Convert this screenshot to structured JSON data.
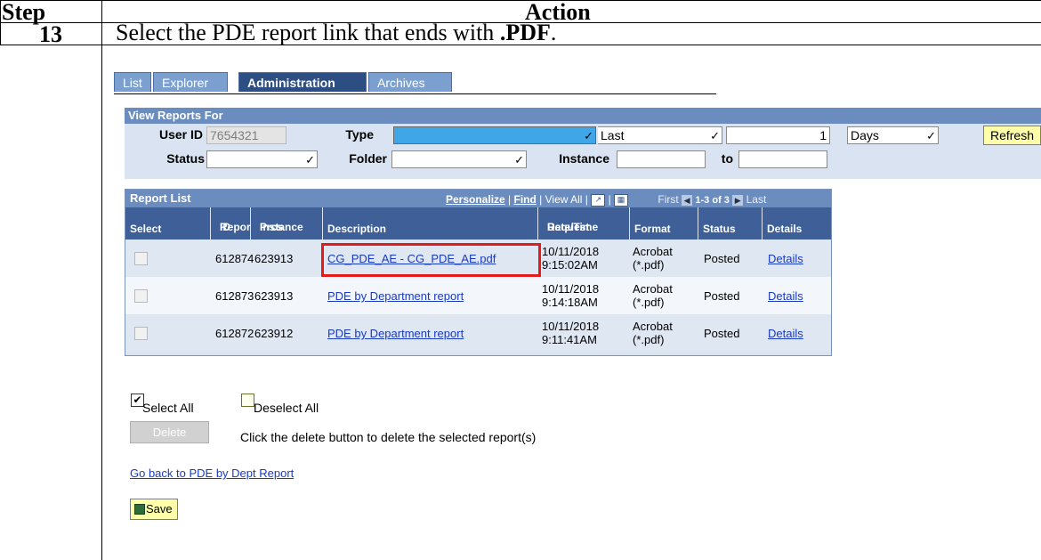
{
  "header": {
    "step": "Step",
    "action": "Action"
  },
  "row": {
    "step_number": "13",
    "instruction_prefix": "Select the PDE report link that ends with ",
    "instruction_bold": ".PDF",
    "instruction_suffix": "."
  },
  "tabs": [
    {
      "label": "List",
      "active": false
    },
    {
      "label": "Explorer",
      "active": false
    },
    {
      "label": "Administration",
      "active": true
    },
    {
      "label": "Archives",
      "active": false
    }
  ],
  "view_reports": {
    "title": "View Reports For",
    "user_id_label": "User ID",
    "user_id_value": "7654321",
    "type_label": "Type",
    "type_value": "",
    "last_value": "Last",
    "last_count": "1",
    "days_value": "Days",
    "refresh_label": "Refresh",
    "status_label": "Status",
    "status_value": "",
    "folder_label": "Folder",
    "folder_value": "",
    "instance_label": "Instance",
    "instance_value": "",
    "to_label": "to",
    "to_value": ""
  },
  "report_list": {
    "title": "Report List",
    "personalize": "Personalize",
    "find": "Find",
    "view_all": "View All",
    "first": "First",
    "range": "1-3 of 3",
    "last": "Last",
    "columns": [
      "Select",
      "Report ID",
      "Prcs Instance",
      "Description",
      "Request Date/Time",
      "Format",
      "Status",
      "Details"
    ],
    "col_select": "Select",
    "col_report_1": "Report",
    "col_report_2": "ID",
    "col_prcs_1": "Prcs",
    "col_prcs_2": "Instance",
    "col_desc": "Description",
    "col_req_1": "Request",
    "col_req_2": "Date/Time",
    "col_format": "Format",
    "col_status": "Status",
    "col_details": "Details",
    "rows": [
      {
        "report_id": "612874",
        "instance": "623913",
        "description": "CG_PDE_AE - CG_PDE_AE.pdf",
        "date": "10/11/2018",
        "time": "9:15:02AM",
        "format_1": "Acrobat",
        "format_2": "(*.pdf)",
        "status": "Posted",
        "details": "Details"
      },
      {
        "report_id": "612873",
        "instance": "623913",
        "description": "PDE by Department report",
        "date": "10/11/2018",
        "time": "9:14:18AM",
        "format_1": "Acrobat",
        "format_2": "(*.pdf)",
        "status": "Posted",
        "details": "Details"
      },
      {
        "report_id": "612872",
        "instance": "623912",
        "description": "PDE by Department report",
        "date": "10/11/2018",
        "time": "9:11:41AM",
        "format_1": "Acrobat",
        "format_2": "(*.pdf)",
        "status": "Posted",
        "details": "Details"
      }
    ]
  },
  "actions": {
    "select_all": "Select All",
    "deselect_all": "Deselect All",
    "delete": "Delete",
    "delete_hint": "Click the delete button to delete the selected report(s)",
    "go_back": "Go back to PDE by Dept Report",
    "save": "Save"
  },
  "colors": {
    "tab_active": "#2c4e82",
    "tab_inactive": "#7ba0cf",
    "panel_bg": "#d9e3f1",
    "header_bg": "#6b8cbf",
    "highlight": "#e21b1b",
    "link": "#1a3bbd"
  }
}
